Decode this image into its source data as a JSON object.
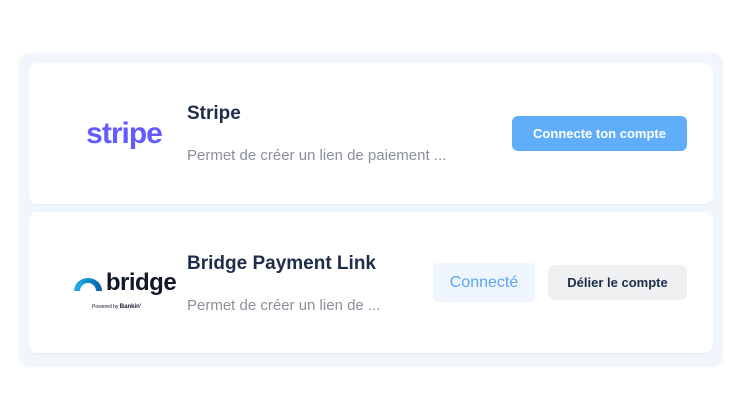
{
  "integrations": [
    {
      "logo_text": "stripe",
      "title": "Stripe",
      "description": "Permet de créer un lien de paiement ...",
      "action_label": "Connecte ton compte"
    },
    {
      "logo_text": "bridge",
      "logo_subtext_prefix": "Powered by",
      "logo_subtext_brand": "Bankin'",
      "title": "Bridge Payment Link",
      "description": "Permet de créer un lien de ...",
      "status_label": "Connecté",
      "action_label": "Délier le compte"
    }
  ],
  "colors": {
    "stripe_brand": "#635bff",
    "primary_button": "#60aefa",
    "status_text": "#5aa6f3",
    "title": "#1e2d4a"
  }
}
